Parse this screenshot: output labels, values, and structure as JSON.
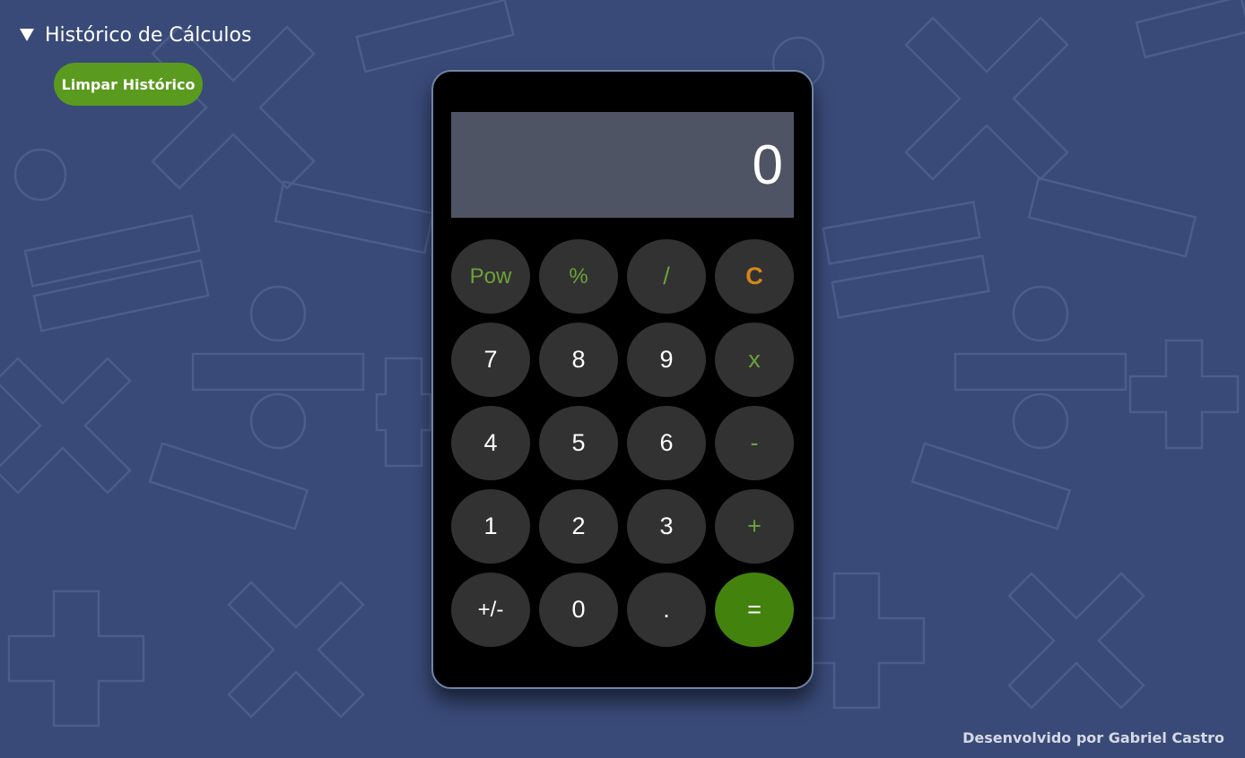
{
  "history": {
    "title": "Histórico de Cálculos",
    "clear_label": "Limpar Histórico"
  },
  "calculator": {
    "display_value": "0",
    "keys": {
      "pow": "Pow",
      "percent": "%",
      "divide": "/",
      "clear": "C",
      "seven": "7",
      "eight": "8",
      "nine": "9",
      "multiply": "x",
      "four": "4",
      "five": "5",
      "six": "6",
      "minus": "-",
      "one": "1",
      "two": "2",
      "three": "3",
      "plus": "+",
      "negate": "+/-",
      "zero": "0",
      "decimal": ".",
      "equals": "="
    }
  },
  "footer": {
    "credit": "Desenvolvido por Gabriel Castro"
  },
  "colors": {
    "background": "#394a78",
    "operator": "#6ba33a",
    "clear": "#d7861a",
    "equals": "#44820e",
    "clear_history_button": "#5a9a1e"
  }
}
